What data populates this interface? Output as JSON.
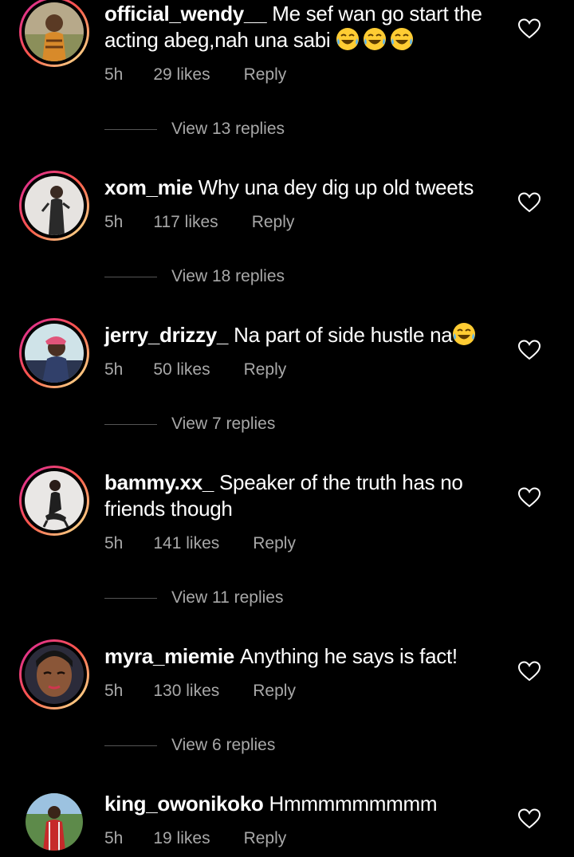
{
  "accent_ring": [
    "#d6249f",
    "#fd5949",
    "#fdf497"
  ],
  "comments": [
    {
      "username": "official_wendy__",
      "text": "Me sef wan go start the acting abeg,nah una sabi",
      "emoji_count": 3,
      "time": "5h",
      "likes": "29 likes",
      "reply": "Reply",
      "view_replies": "View 13 replies",
      "story_ring": true
    },
    {
      "username": "xom_mie",
      "text": "Why una dey dig up old tweets",
      "emoji_count": 0,
      "time": "5h",
      "likes": "117 likes",
      "reply": "Reply",
      "view_replies": "View 18 replies",
      "story_ring": true
    },
    {
      "username": "jerry_drizzy_",
      "text": "Na part of side hustle na",
      "emoji_count": 1,
      "time": "5h",
      "likes": "50 likes",
      "reply": "Reply",
      "view_replies": "View 7 replies",
      "story_ring": true
    },
    {
      "username": "bammy.xx_",
      "text": "Speaker of the truth has no friends though",
      "emoji_count": 0,
      "time": "5h",
      "likes": "141 likes",
      "reply": "Reply",
      "view_replies": "View 11 replies",
      "story_ring": true
    },
    {
      "username": "myra_miemie",
      "text": "Anything he says is fact!",
      "emoji_count": 0,
      "time": "5h",
      "likes": "130 likes",
      "reply": "Reply",
      "view_replies": "View 6 replies",
      "story_ring": true
    },
    {
      "username": "king_owonikoko",
      "text": "Hmmmmmmmmm",
      "emoji_count": 0,
      "time": "5h",
      "likes": "19 likes",
      "reply": "Reply",
      "story_ring": false
    }
  ]
}
